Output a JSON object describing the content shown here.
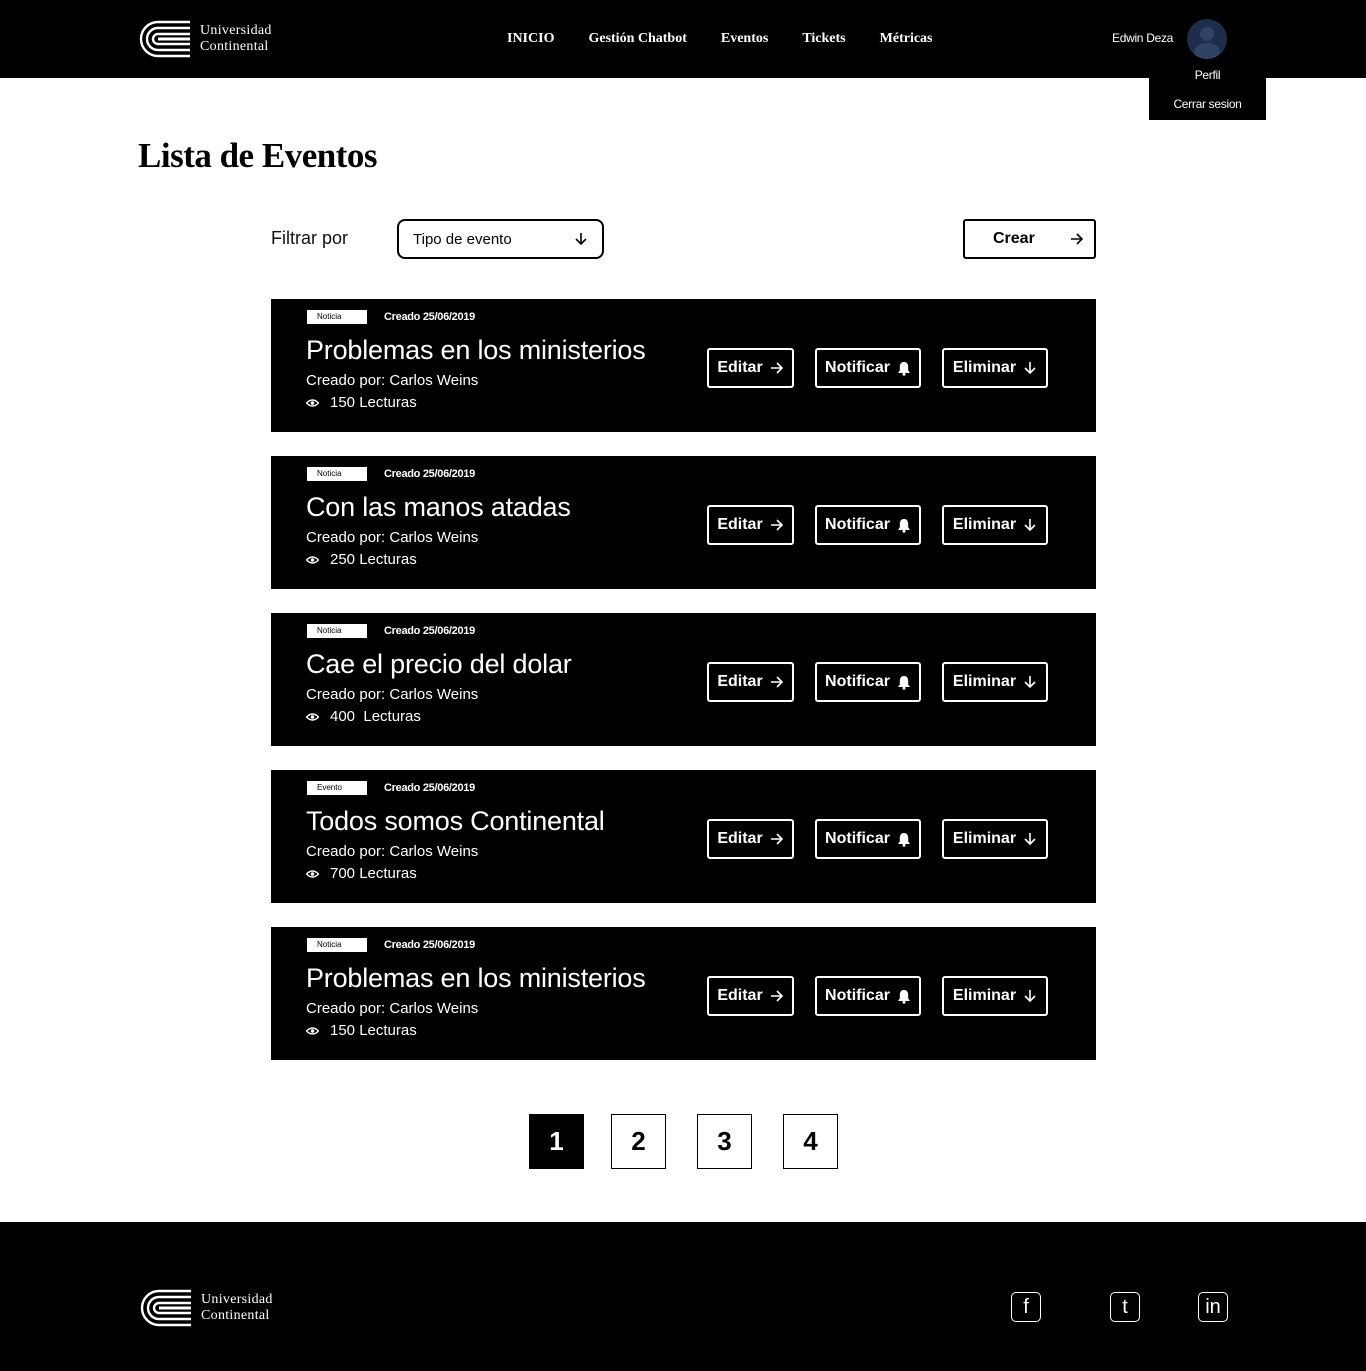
{
  "header": {
    "logo_line1": "Universidad",
    "logo_line2": "Continental",
    "nav": [
      "INICIO",
      "Gestión Chatbot",
      "Eventos",
      "Tickets",
      "Métricas"
    ],
    "user_name": "Edwin Deza",
    "user_menu": {
      "profile": "Perfil",
      "logout": "Cerrar sesion"
    }
  },
  "main": {
    "title": "Lista de Eventos",
    "filter_label": "Filtrar por",
    "filter_value": "Tipo de evento",
    "create_label": "Crear"
  },
  "events": [
    {
      "type": "Noticia",
      "created": "Creado 25/06/2019",
      "title": "Problemas en los ministerios",
      "author": "Creado por: Carlos Weins",
      "reads": "150 Lecturas"
    },
    {
      "type": "Noticia",
      "created": "Creado 25/06/2019",
      "title": "Con las manos atadas",
      "author": "Creado por: Carlos Weins",
      "reads": "250 Lecturas"
    },
    {
      "type": "Noticia",
      "created": "Creado 25/06/2019",
      "title": "Cae el precio del dolar",
      "author": "Creado por: Carlos Weins",
      "reads": "400  Lecturas"
    },
    {
      "type": "Evento",
      "created": "Creado 25/06/2019",
      "title": "Todos somos Continental",
      "author": "Creado por: Carlos Weins",
      "reads": "700 Lecturas"
    },
    {
      "type": "Noticia",
      "created": "Creado 25/06/2019",
      "title": "Problemas en los ministerios",
      "author": "Creado por: Carlos Weins",
      "reads": "150 Lecturas"
    }
  ],
  "card_actions": {
    "edit": "Editar",
    "notify": "Notificar",
    "delete": "Eliminar"
  },
  "pagination": {
    "pages": [
      "1",
      "2",
      "3",
      "4"
    ],
    "active": "1"
  },
  "footer": {
    "logo_line1": "Universidad",
    "logo_line2": "Continental",
    "social": [
      {
        "icon": "facebook-icon",
        "glyph": "f"
      },
      {
        "icon": "tumblr-icon",
        "glyph": "t"
      },
      {
        "icon": "linkedin-icon",
        "glyph": "in"
      }
    ]
  },
  "colors": {
    "primary": "#000000",
    "background": "#ffffff",
    "avatar": "#1c2e4a"
  }
}
